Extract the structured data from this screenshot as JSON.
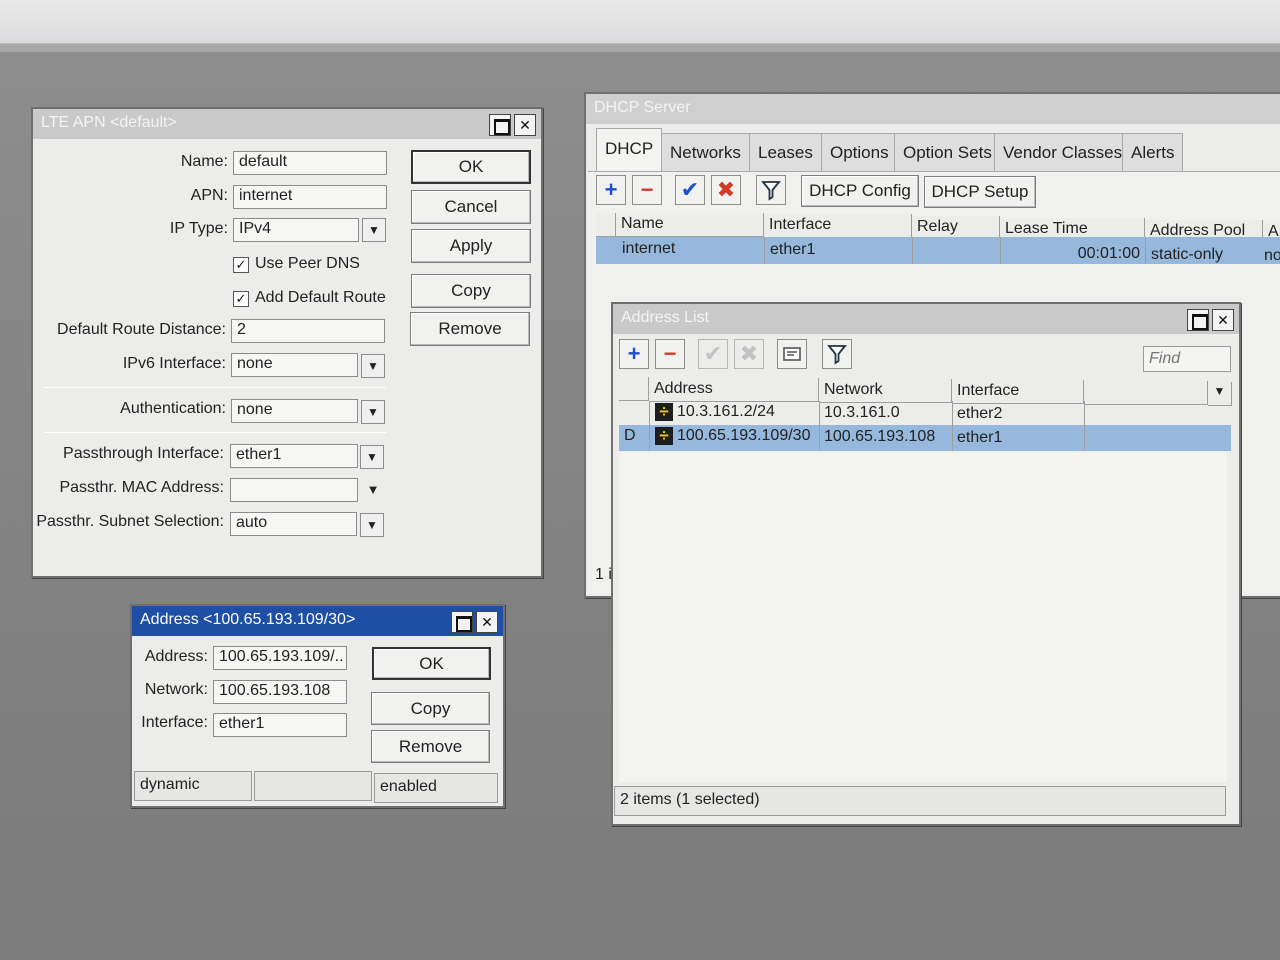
{
  "colors": {
    "active_titlebar": "#1f4fa5",
    "inactive_titlebar": "#c9c9c9",
    "selected_row": "#95b8dc",
    "add_icon": "#1f4fcc",
    "remove_icon": "#d23a2a",
    "enable_icon": "#1f4fcc",
    "disable_icon": "#d23a2a"
  },
  "lte_apn": {
    "title": "LTE APN <default>",
    "labels": {
      "name": "Name:",
      "apn": "APN:",
      "ip_type": "IP Type:",
      "use_peer_dns": "Use Peer DNS",
      "add_default_route": "Add Default Route",
      "default_route_distance": "Default Route Distance:",
      "ipv6_interface": "IPv6 Interface:",
      "authentication": "Authentication:",
      "passthrough_interface": "Passthrough Interface:",
      "passthr_mac": "Passthr. MAC Address:",
      "passthr_subnet": "Passthr. Subnet Selection:"
    },
    "values": {
      "name": "default",
      "apn": "internet",
      "ip_type": "IPv4",
      "use_peer_dns": true,
      "add_default_route": true,
      "default_route_distance": "2",
      "ipv6_interface": "none",
      "authentication": "none",
      "passthrough_interface": "ether1",
      "passthr_mac": "",
      "passthr_subnet": "auto"
    },
    "buttons": {
      "ok": "OK",
      "cancel": "Cancel",
      "apply": "Apply",
      "copy": "Copy",
      "remove": "Remove"
    }
  },
  "address_dialog": {
    "title": "Address <100.65.193.109/30>",
    "labels": {
      "address": "Address:",
      "network": "Network:",
      "interface": "Interface:"
    },
    "values": {
      "address": "100.65.193.109/..",
      "network": "100.65.193.108",
      "interface": "ether1"
    },
    "buttons": {
      "ok": "OK",
      "copy": "Copy",
      "remove": "Remove"
    },
    "status": {
      "left": "dynamic",
      "middle": "",
      "right": "enabled"
    }
  },
  "dhcp_server": {
    "title": "DHCP Server",
    "tabs": [
      "DHCP",
      "Networks",
      "Leases",
      "Options",
      "Option Sets",
      "Vendor Classes",
      "Alerts"
    ],
    "toolbar": {
      "add_icon": "+",
      "remove_icon": "−",
      "enable_icon": "✔",
      "disable_icon": "✖",
      "filter_icon": "filter-funnel",
      "dhcp_config": "DHCP Config",
      "dhcp_setup": "DHCP Setup"
    },
    "columns": [
      "Name",
      "Interface",
      "Relay",
      "Lease Time",
      "Address Pool",
      "A"
    ],
    "rows": [
      {
        "name": "internet",
        "interface": "ether1",
        "relay": "",
        "lease_time": "00:01:00",
        "address_pool": "static-only",
        "extra": "no"
      }
    ],
    "status_partial": "1 i"
  },
  "address_list": {
    "title": "Address List",
    "find_placeholder": "Find",
    "columns": [
      "Address",
      "Network",
      "Interface"
    ],
    "rows": [
      {
        "flag": "",
        "address": "10.3.161.2/24",
        "network": "10.3.161.0",
        "interface": "ether2",
        "selected": false
      },
      {
        "flag": "D",
        "address": "100.65.193.109/30",
        "network": "100.65.193.108",
        "interface": "ether1",
        "selected": true
      }
    ],
    "status": "2 items (1 selected)"
  }
}
